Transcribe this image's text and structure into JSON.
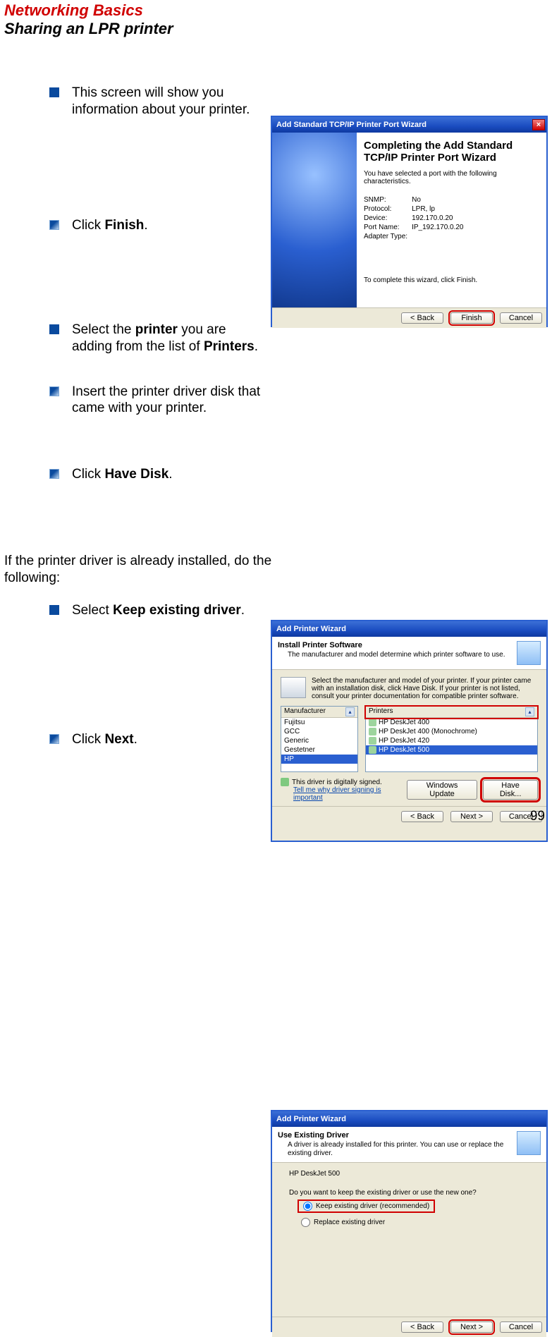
{
  "page": {
    "title_red": "Networking Basics",
    "title_black": "Sharing an LPR printer",
    "page_number": "99"
  },
  "bullets": {
    "b1": "This screen will show you information about your printer.",
    "b2_pre": "Click ",
    "b2_bold": "Finish",
    "b2_post": ".",
    "b3_pre": "Select the ",
    "b3_bold1": "printer",
    "b3_mid": " you are adding from the list of ",
    "b3_bold2": "Printers",
    "b3_post": ".",
    "b4": "Insert the printer driver disk that came with your printer.",
    "b5_pre": "Click ",
    "b5_bold": "Have Disk",
    "b5_post": ".",
    "para": "If the printer driver is already installed, do the following:",
    "b6_pre": "Select ",
    "b6_bold": "Keep existing driver",
    "b6_post": ".",
    "b7_pre": "Click ",
    "b7_bold": "Next",
    "b7_post": "."
  },
  "dlg1": {
    "title": "Add Standard TCP/IP Printer Port Wizard",
    "heading": "Completing the Add Standard TCP/IP Printer Port Wizard",
    "sub": "You have selected a port with the following characteristics.",
    "rows": [
      [
        "SNMP:",
        "No"
      ],
      [
        "Protocol:",
        "LPR, lp"
      ],
      [
        "Device:",
        "192.170.0.20"
      ],
      [
        "Port Name:",
        "IP_192.170.0.20"
      ],
      [
        "Adapter Type:",
        ""
      ]
    ],
    "finish_note": "To complete this wizard, click Finish.",
    "btn_back": "< Back",
    "btn_finish": "Finish",
    "btn_cancel": "Cancel"
  },
  "dlg2": {
    "title": "Add Printer Wizard",
    "hdr_title": "Install Printer Software",
    "hdr_sub": "The manufacturer and model determine which printer software to use.",
    "instr": "Select the manufacturer and model of your printer. If your printer came with an installation disk, click Have Disk. If your printer is not listed, consult your printer documentation for compatible printer software.",
    "col_mfr": "Manufacturer",
    "col_prn": "Printers",
    "mfr_items": [
      "Fujitsu",
      "GCC",
      "Generic",
      "Gestetner",
      "HP"
    ],
    "prn_items": [
      "HP DeskJet 400",
      "HP DeskJet 400 (Monochrome)",
      "HP DeskJet 420",
      "HP DeskJet 500"
    ],
    "signed": "This driver is digitally signed.",
    "why_link": "Tell me why driver signing is important",
    "btn_wu": "Windows Update",
    "btn_hd": "Have Disk...",
    "btn_back": "< Back",
    "btn_next": "Next >",
    "btn_cancel": "Cancel"
  },
  "dlg3": {
    "title": "Add Printer Wizard",
    "hdr_title": "Use Existing Driver",
    "hdr_sub": "A driver is already installed for this printer. You can use or replace the existing driver.",
    "printer_name": "HP DeskJet 500",
    "question": "Do you want to keep the existing driver or use the new one?",
    "opt_keep": "Keep existing driver (recommended)",
    "opt_replace": "Replace existing driver",
    "btn_back": "< Back",
    "btn_next": "Next >",
    "btn_cancel": "Cancel"
  }
}
